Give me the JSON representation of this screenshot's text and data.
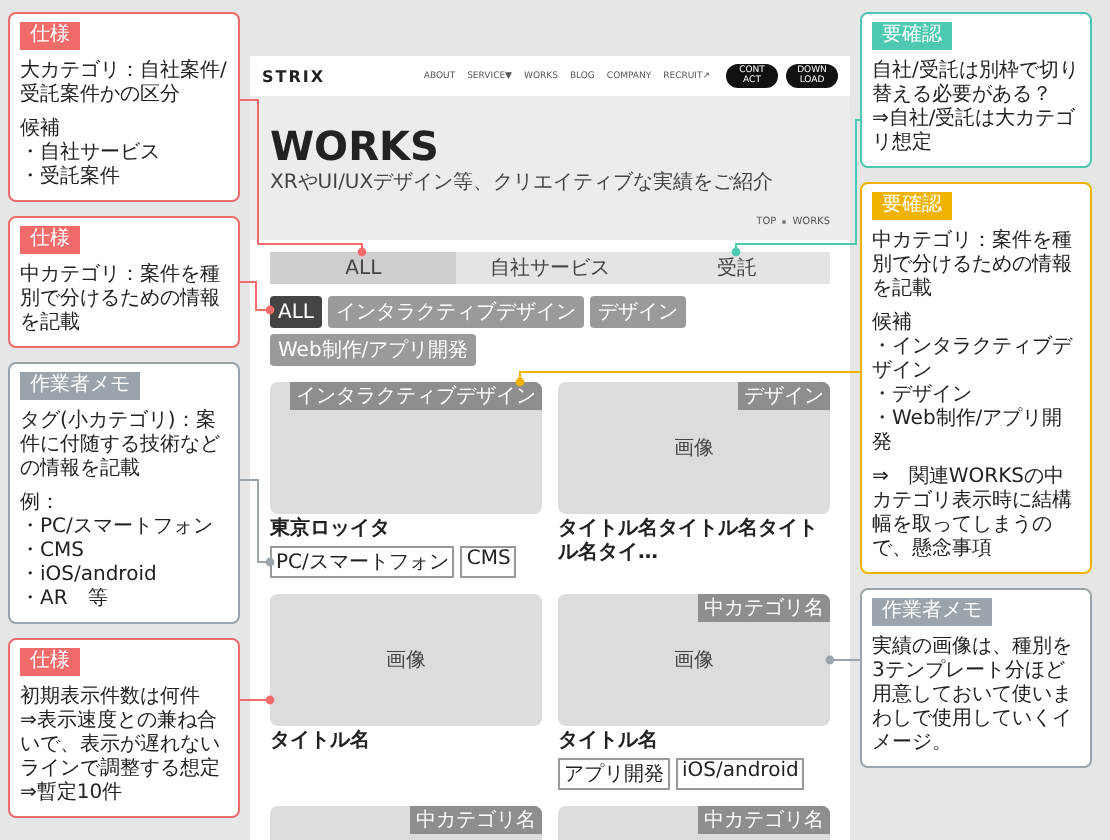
{
  "header": {
    "logo": "STRIX",
    "nav": [
      "ABOUT",
      "SERVICE▼",
      "WORKS",
      "BLOG",
      "COMPANY",
      "RECRUIT↗"
    ],
    "buttons": [
      "CONT ACT",
      "DOWN LOAD"
    ]
  },
  "hero": {
    "title": "WORKS",
    "subtitle": "XRやUI/UXデザイン等、クリエイティブな実績をご紹介",
    "breadcrumb": [
      "TOP",
      "WORKS"
    ]
  },
  "tabs": [
    {
      "label": "ALL",
      "selected": true
    },
    {
      "label": "自社サービス",
      "selected": false
    },
    {
      "label": "受託",
      "selected": false
    }
  ],
  "chips": [
    {
      "label": "ALL",
      "selected": true
    },
    {
      "label": "インタラクティブデザイン",
      "selected": false
    },
    {
      "label": "デザイン",
      "selected": false
    },
    {
      "label": "Web制作/アプリ開発",
      "selected": false
    }
  ],
  "cards": [
    {
      "badge": "インタラクティブデザイン",
      "title": "東京ロッイタ",
      "tags": [
        "PC/スマートフォン",
        "CMS"
      ]
    },
    {
      "badge": "デザイン",
      "image_label": "画像",
      "title": "タイトル名タイトル名タイトル名タイ…"
    },
    {
      "image_label": "画像",
      "title": "タイトル名"
    },
    {
      "badge": "中カテゴリ名",
      "image_label": "画像",
      "title": "タイトル名",
      "tags": [
        "アプリ開発",
        "iOS/android"
      ]
    },
    {
      "badge": "中カテゴリ名"
    },
    {
      "badge": "中カテゴリ名"
    }
  ],
  "notes_left": [
    {
      "label": "仕様",
      "color": "#f26b6b",
      "paragraphs": [
        [
          "大カテゴリ：自社案件/受託案件かの区分"
        ],
        [
          "候補",
          "・自社サービス",
          "・受託案件"
        ]
      ]
    },
    {
      "label": "仕様",
      "color": "#f26b6b",
      "paragraphs": [
        [
          "中カテゴリ：案件を種別で分けるための情報を記載"
        ]
      ]
    },
    {
      "label": "作業者メモ",
      "color": "#9aa4aa",
      "paragraphs": [
        [
          "タグ(小カテゴリ)：案件に付随する技術などの情報を記載"
        ],
        [
          "例：",
          "・PC/スマートフォン",
          "・CMS",
          "・iOS/android",
          "・AR　等"
        ]
      ]
    },
    {
      "label": "仕様",
      "color": "#f26b6b",
      "paragraphs": [
        [
          "初期表示件数は何件",
          "⇒表示速度との兼ね合いで、表示が遅れないラインで調整する想定",
          "⇒暫定10件"
        ]
      ]
    }
  ],
  "notes_right": [
    {
      "label": "要確認",
      "color": "#4cc9b0",
      "paragraphs": [
        [
          "自社/受託は別枠で切り替える必要がある？",
          "⇒自社/受託は大カテゴリ想定"
        ]
      ]
    },
    {
      "label": "要確認",
      "color": "#f0b400",
      "paragraphs": [
        [
          "中カテゴリ：案件を種別で分けるための情報を記載"
        ],
        [
          "候補",
          "・インタラクティブデザイン",
          "・デザイン",
          "・Web制作/アプリ開発"
        ],
        [
          "⇒　関連WORKSの中カテゴリ表示時に結構幅を取ってしまうので、懸念事項"
        ]
      ]
    },
    {
      "label": "作業者メモ",
      "color": "#9aa4aa",
      "paragraphs": [
        [
          "実績の画像は、種別を3テンプレート分ほど用意しておいて使いまわしで使用していくイメージ。"
        ]
      ]
    }
  ]
}
